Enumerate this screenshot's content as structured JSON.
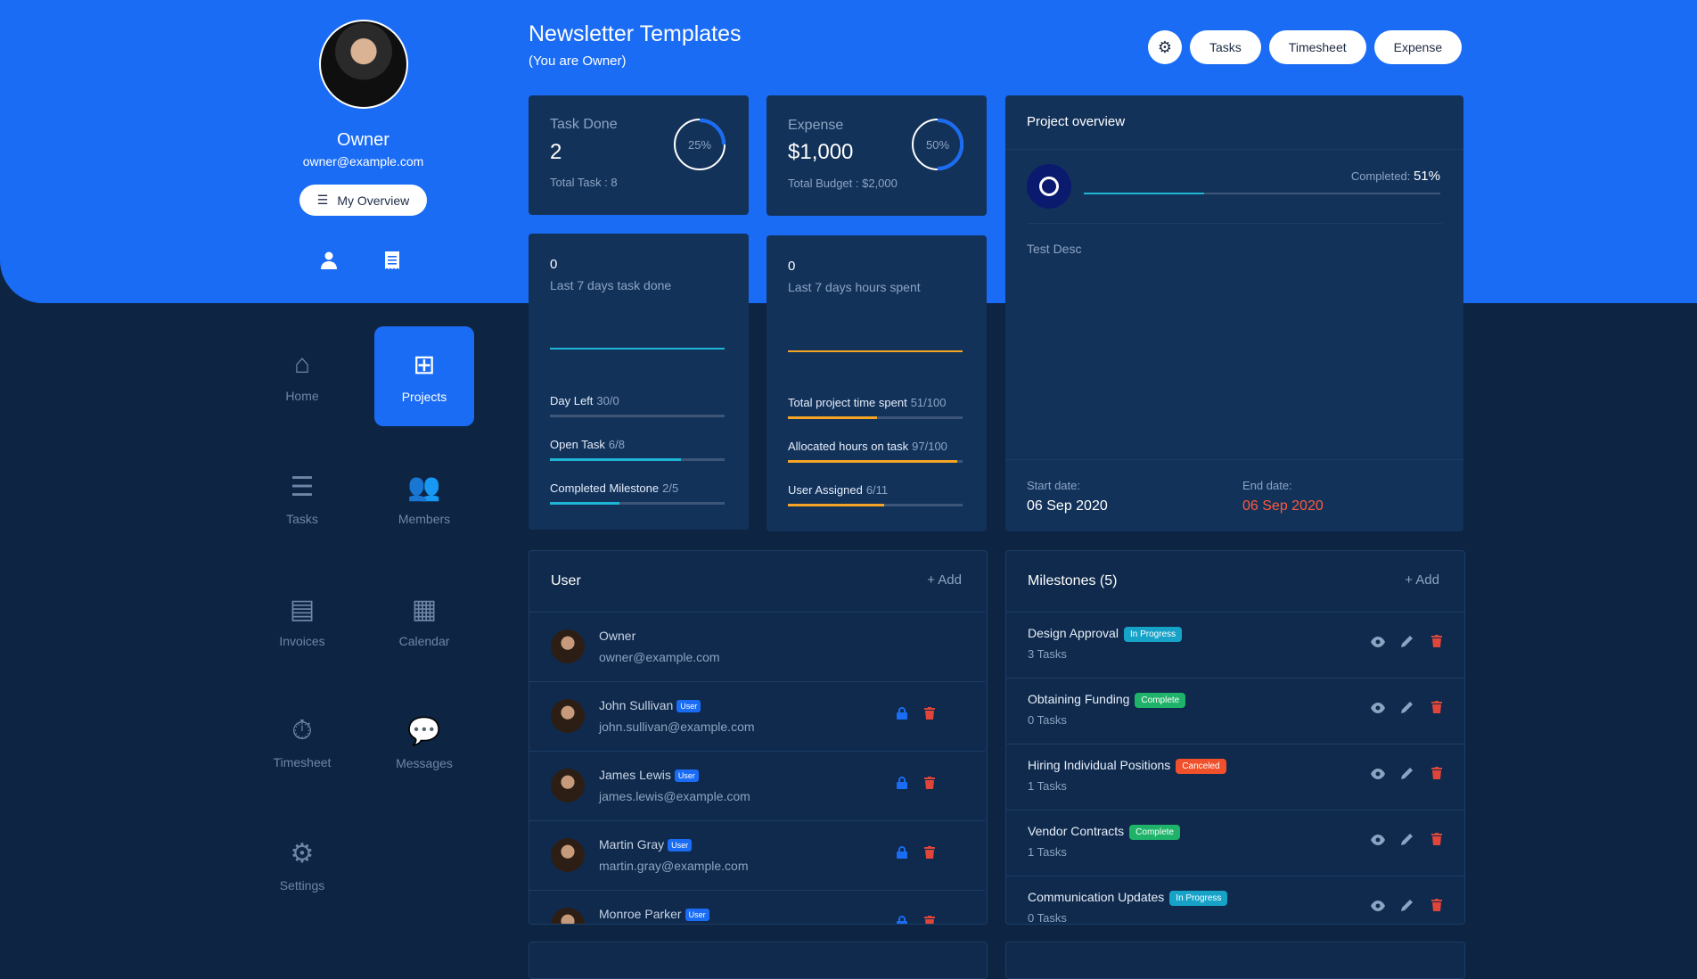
{
  "profile": {
    "name": "Owner",
    "email": "owner@example.com",
    "overview_label": "My Overview"
  },
  "header": {
    "title": "Newsletter Templates",
    "subtitle": "(You are Owner)"
  },
  "toolbar": {
    "tasks": "Tasks",
    "timesheet": "Timesheet",
    "expense": "Expense"
  },
  "nav": [
    {
      "label": "Home",
      "icon": "home-icon"
    },
    {
      "label": "Projects",
      "icon": "projects-icon"
    },
    {
      "label": "Tasks",
      "icon": "tasks-icon"
    },
    {
      "label": "Members",
      "icon": "members-icon"
    },
    {
      "label": "Invoices",
      "icon": "invoices-icon"
    },
    {
      "label": "Calendar",
      "icon": "calendar-icon"
    },
    {
      "label": "Timesheet",
      "icon": "timesheet-icon"
    },
    {
      "label": "Messages",
      "icon": "messages-icon"
    },
    {
      "label": "Settings",
      "icon": "settings-icon"
    }
  ],
  "stats": {
    "task_done": {
      "label": "Task Done",
      "value": "2",
      "total": "Total Task : 8",
      "percent": "25%",
      "fraction": 0.25
    },
    "expense": {
      "label": "Expense",
      "value": "$1,000",
      "total": "Total Budget : $2,000",
      "percent": "50%",
      "fraction": 0.5
    }
  },
  "tasks_card": {
    "count": "0",
    "caption": "Last 7 days task done",
    "rows": [
      {
        "label": "Day Left",
        "value": "30/0",
        "fraction": 0.0,
        "color": "#1fb6d6"
      },
      {
        "label": "Open Task",
        "value": "6/8",
        "fraction": 0.75,
        "color": "#1fb6d6"
      },
      {
        "label": "Completed Milestone",
        "value": "2/5",
        "fraction": 0.4,
        "color": "#1fb6d6"
      }
    ]
  },
  "hours_card": {
    "count": "0",
    "caption": "Last 7 days hours spent",
    "rows": [
      {
        "label": "Total project time spent",
        "value": "51/100",
        "fraction": 0.51,
        "color": "#f5a524"
      },
      {
        "label": "Allocated hours on task",
        "value": "97/100",
        "fraction": 0.97,
        "color": "#f5a524"
      },
      {
        "label": "User Assigned",
        "value": "6/11",
        "fraction": 0.55,
        "color": "#f5a524"
      }
    ]
  },
  "project_overview": {
    "title": "Project overview",
    "completed_label": "Completed:",
    "completed_value": "51%",
    "fraction": 0.51,
    "description": "Test Desc",
    "start_label": "Start date:",
    "start_value": "06 Sep 2020",
    "end_label": "End date:",
    "end_value": "06 Sep 2020"
  },
  "users": {
    "title": "User",
    "add_label": "Add",
    "items": [
      {
        "name": "Owner",
        "email": "owner@example.com",
        "badge": ""
      },
      {
        "name": "John Sullivan",
        "email": "john.sullivan@example.com",
        "badge": "User"
      },
      {
        "name": "James Lewis",
        "email": "james.lewis@example.com",
        "badge": "User"
      },
      {
        "name": "Martin Gray",
        "email": "martin.gray@example.com",
        "badge": "User"
      },
      {
        "name": "Monroe Parker",
        "email": "",
        "badge": "User"
      }
    ]
  },
  "milestones": {
    "title": "Milestones (5)",
    "add_label": "Add",
    "items": [
      {
        "name": "Design Approval",
        "status": "In Progress",
        "status_color": "#17a2c8",
        "tasks": "3 Tasks"
      },
      {
        "name": "Obtaining Funding",
        "status": "Complete",
        "status_color": "#1fb36a",
        "tasks": "0 Tasks"
      },
      {
        "name": "Hiring Individual Positions",
        "status": "Canceled",
        "status_color": "#f0502c",
        "tasks": "1 Tasks"
      },
      {
        "name": "Vendor Contracts",
        "status": "Complete",
        "status_color": "#1fb36a",
        "tasks": "1 Tasks"
      },
      {
        "name": "Communication Updates",
        "status": "In Progress",
        "status_color": "#17a2c8",
        "tasks": "0 Tasks"
      }
    ]
  }
}
